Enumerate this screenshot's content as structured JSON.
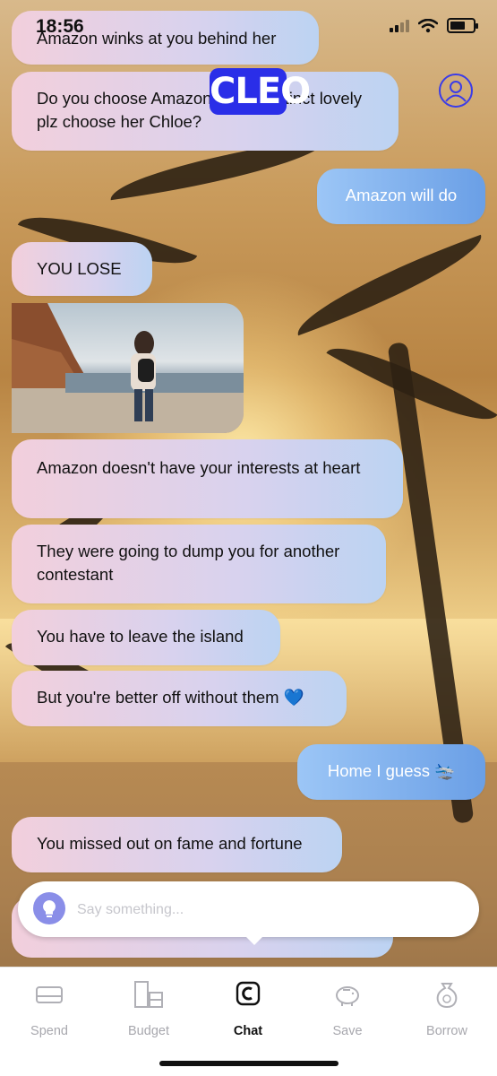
{
  "status_bar": {
    "time": "18:56"
  },
  "header": {
    "logo": "CLEO"
  },
  "messages": [
    {
      "from": "cleo",
      "text": "Amazon winks at you behind her"
    },
    {
      "from": "cleo",
      "text": "Do you choose Amazon or the distinct lovely plz choose her Chloe?"
    },
    {
      "from": "user",
      "text": "Amazon will do"
    },
    {
      "from": "cleo",
      "text": "YOU LOSE"
    },
    {
      "from": "cleo",
      "text": "Amazon doesn't have your interests at heart"
    },
    {
      "from": "cleo",
      "text": "They were going to dump you for another contestant"
    },
    {
      "from": "cleo",
      "text": "You have to leave the island"
    },
    {
      "from": "cleo",
      "text": "But you're better off without them 💙"
    },
    {
      "from": "user",
      "text": "Home I guess 🛬"
    },
    {
      "from": "cleo",
      "text": "You missed out on fame and fortune"
    }
  ],
  "composer": {
    "placeholder": "Say something..."
  },
  "nav": {
    "items": [
      {
        "label": "Spend",
        "icon": "card-icon"
      },
      {
        "label": "Budget",
        "icon": "budget-icon"
      },
      {
        "label": "Chat",
        "icon": "chat-c-icon",
        "active": true
      },
      {
        "label": "Save",
        "icon": "piggy-bank-icon"
      },
      {
        "label": "Borrow",
        "icon": "money-bag-icon"
      }
    ]
  },
  "colors": {
    "brand": "#2a2ee8",
    "user_bubble": "#6a9fe6"
  }
}
